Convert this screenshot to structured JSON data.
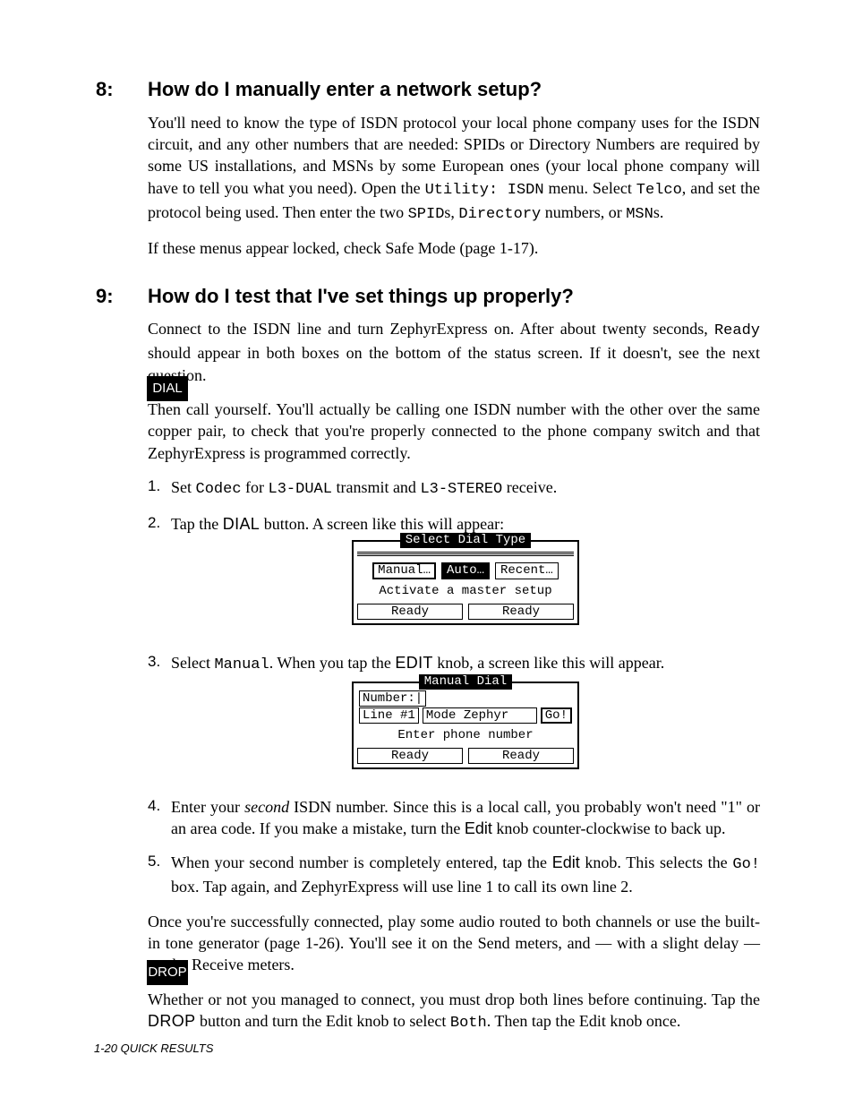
{
  "s8": {
    "num": "8:",
    "title": "How do I manually enter a network setup?",
    "p1a": "You'll need to know the type of ISDN protocol your local phone company uses for the ISDN circuit, and any other numbers that are needed: SPIDs or Directory Numbers are required by some US installations, and MSNs by some European ones (your local phone company will have to tell you what you need). Open the ",
    "p1m1": "Utility: ISDN",
    "p1b": " menu. Select ",
    "p1m2": "Telco",
    "p1c": ", and set the protocol being used. Then enter the two ",
    "p1m3": "SPID",
    "p1d": "s, ",
    "p1m4": "Directory",
    "p1e": " numbers, or ",
    "p1m5": "MSN",
    "p1f": "s.",
    "p2": "If these menus appear locked, check Safe Mode (page 1-17)."
  },
  "s9": {
    "num": "9:",
    "title": "How do I test that I've set things up properly?",
    "p1a": "Connect to the ISDN line and turn ZephyrExpress on. After about twenty seconds, ",
    "p1m1": "Ready",
    "p1b": " should appear in both boxes on the bottom of the status screen. If it doesn't, see the next question.",
    "p2": "Then call yourself. You'll actually be calling one ISDN number with the other over the same copper pair, to check that you're properly connected to the phone company switch and that ZephyrExpress is programmed correctly.",
    "badge1": "DIAL",
    "li1a": "Set ",
    "li1m1": "Codec",
    "li1b": " for ",
    "li1m2": "L3-DUAL",
    "li1c": " transmit and ",
    "li1m3": "L3-STEREO",
    "li1d": " receive.",
    "li2a": "Tap the ",
    "li2s": "DIAL",
    "li2b": " button. A screen like this will appear:",
    "lcd1": {
      "title": "Select Dial Type",
      "b1": "Manual…",
      "b2": "Auto…",
      "b3": "Recent…",
      "msg": "Activate a master setup",
      "s1": "Ready",
      "s2": "Ready"
    },
    "li3a": "Select ",
    "li3m": "Manual",
    "li3b": ". When you tap the ",
    "li3s": "EDIT",
    "li3c": " knob, a screen like this will appear.",
    "lcd2": {
      "title": "Manual Dial",
      "num": "Number:|",
      "c1": "Line #1",
      "c2": "Mode Zephyr",
      "c3": "Go!",
      "msg": "Enter phone number",
      "s1": "Ready",
      "s2": "Ready"
    },
    "li4a": "Enter your ",
    "li4i": "second",
    "li4b": " ISDN number. Since this is a local call, you probably won't need \"1\" or an area code. If you make a mistake, turn the ",
    "li4s": "Edit",
    "li4c": " knob counter-clockwise to back up.",
    "li5a": "When your second number is completely entered, tap the ",
    "li5s": "Edit",
    "li5b": " knob. This selects the ",
    "li5m": "Go!",
    "li5c": " box. Tap again, and ZephyrExpress will use line 1 to call its own line 2.",
    "p3": "Once you're successfully connected, play some audio routed to both channels or use the built-in tone generator (page 1-26). You'll see it on the Send meters, and — with a slight delay — on the Receive meters.",
    "badge2": "DROP",
    "p4a": "Whether or not you managed to connect, you must drop both lines before continuing. Tap the ",
    "p4s": "DROP",
    "p4b": " button and turn the Edit knob to select ",
    "p4m": "Both",
    "p4c": ". Then tap the Edit knob once."
  },
  "footer": "1-20   QUICK RESULTS"
}
